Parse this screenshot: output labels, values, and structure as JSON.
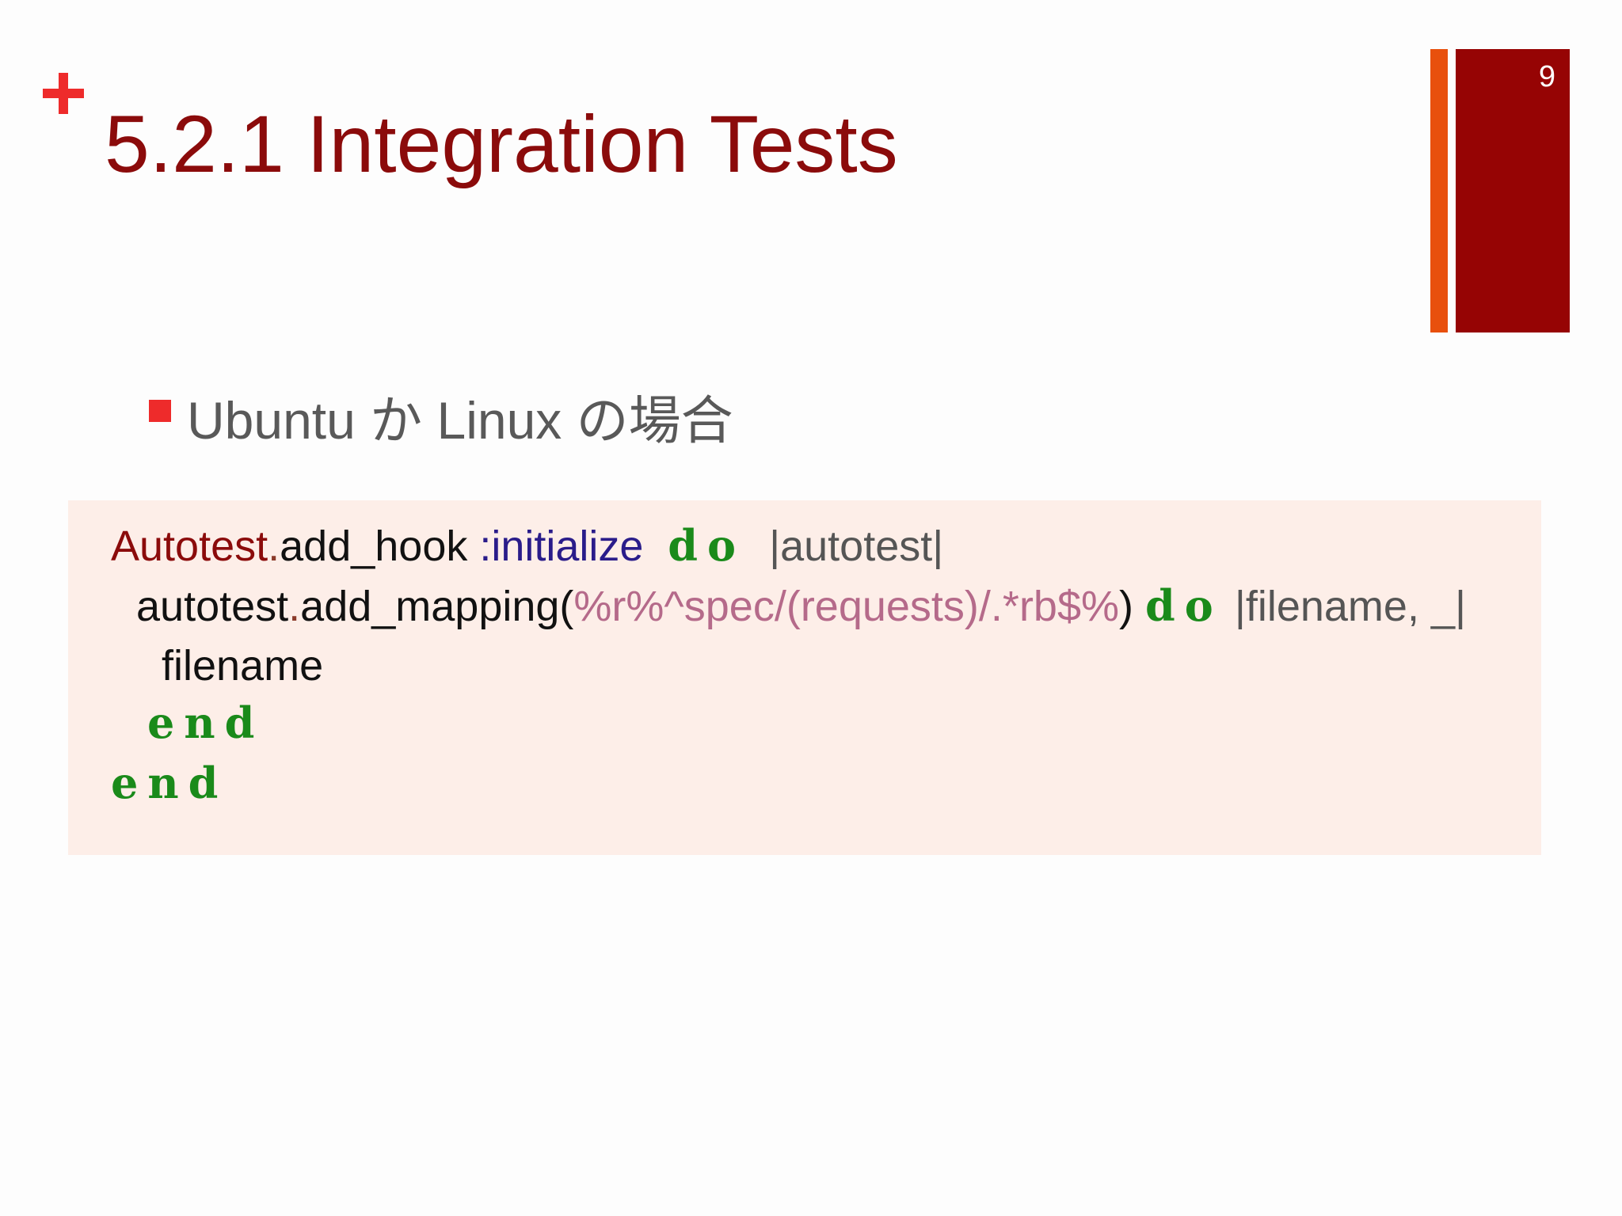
{
  "slide": {
    "title": "5.2.1 Integration Tests",
    "page_number": "9",
    "bullet": "Ubuntu か Linux の場合"
  },
  "code": {
    "line1": {
      "class_name": "Autotest",
      "dot": ".",
      "method": "add_hook ",
      "symbol": ":initialize",
      "keyword": " do",
      "spacer": "  ",
      "block_args": "|autotest|"
    },
    "line2": {
      "receiver": "autotest",
      "dot": ".",
      "method": "add_mapping(",
      "regex": "%r%^spec/(requests)/.*rb$%",
      "close": ") ",
      "keyword": "do",
      "spacer": " ",
      "block_args": "|filename, _|"
    },
    "line3": {
      "text": "filename"
    },
    "line4": {
      "keyword": "end"
    },
    "line5": {
      "keyword": "end"
    }
  },
  "colors": {
    "title": "#8b0b0b",
    "accent_bar": "#e8500d",
    "number_block": "#960404",
    "bullet": "#ee2b2b",
    "code_background": "#fdeee8",
    "keyword": "#1a8a1a",
    "regex": "#b56a8a",
    "symbol": "#2a1c8a"
  }
}
